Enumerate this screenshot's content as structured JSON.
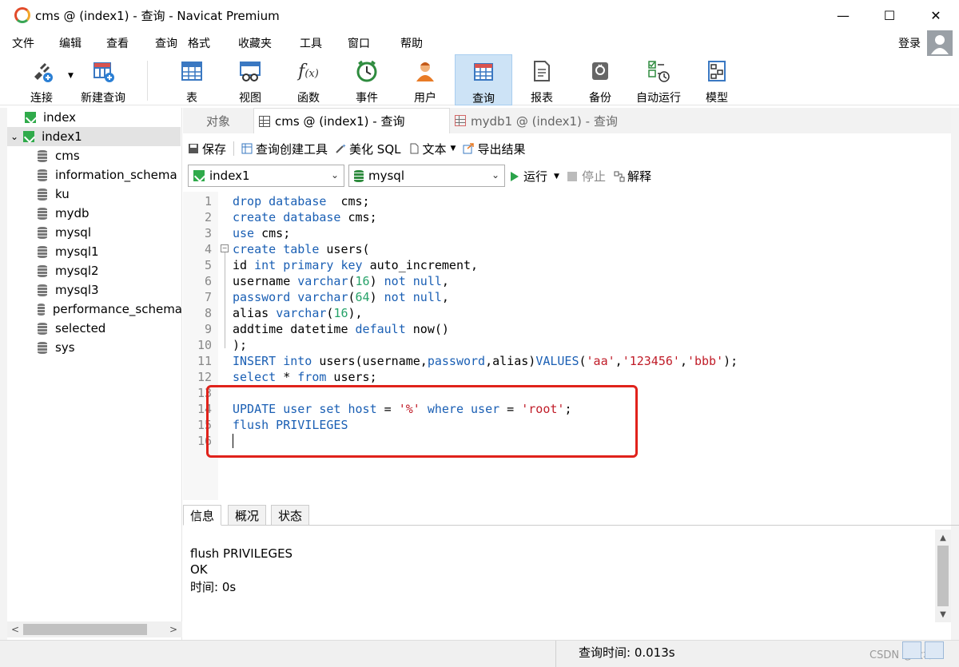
{
  "window": {
    "title": "cms @ (index1) - 查询 - Navicat Premium",
    "minimize": "—",
    "maximize": "☐",
    "close": "✕"
  },
  "menu": {
    "items": [
      "文件",
      "编辑",
      "查看",
      "查询",
      "格式",
      "收藏夹",
      "工具",
      "窗口",
      "帮助"
    ],
    "login": "登录"
  },
  "toolbar": {
    "items": [
      {
        "label": "连接",
        "icon": "plug-icon"
      },
      {
        "label": "新建查询",
        "icon": "new-query-icon"
      },
      {
        "label": "表",
        "icon": "table-icon"
      },
      {
        "label": "视图",
        "icon": "view-icon"
      },
      {
        "label": "函数",
        "icon": "function-icon"
      },
      {
        "label": "事件",
        "icon": "clock-icon"
      },
      {
        "label": "用户",
        "icon": "user-icon"
      },
      {
        "label": "查询",
        "icon": "query-icon",
        "active": true
      },
      {
        "label": "报表",
        "icon": "report-icon"
      },
      {
        "label": "备份",
        "icon": "backup-icon"
      },
      {
        "label": "自动运行",
        "icon": "automation-icon"
      },
      {
        "label": "模型",
        "icon": "model-icon"
      }
    ]
  },
  "sidebar": {
    "connections": [
      {
        "name": "index"
      },
      {
        "name": "index1",
        "expanded": true,
        "selected": true
      }
    ],
    "databases": [
      "cms",
      "information_schema",
      "ku",
      "mydb",
      "mysql",
      "mysql1",
      "mysql2",
      "mysql3",
      "performance_schema",
      "selected",
      "sys"
    ]
  },
  "tabs": {
    "objects": "对象",
    "active": "cms @ (index1) - 查询",
    "other": "mydb1 @ (index1) - 查询"
  },
  "query_toolbar": {
    "save": "保存",
    "builder": "查询创建工具",
    "beautify": "美化 SQL",
    "text": "文本",
    "export": "导出结果"
  },
  "selectors": {
    "connection": "index1",
    "database": "mysql",
    "run": "运行",
    "stop": "停止",
    "explain": "解释"
  },
  "editor": {
    "lines": [
      {
        "n": "1",
        "segs": [
          [
            "kw",
            "drop database"
          ],
          [
            "",
            "  cms;"
          ]
        ]
      },
      {
        "n": "2",
        "segs": [
          [
            "kw",
            "create database"
          ],
          [
            "",
            " cms;"
          ]
        ]
      },
      {
        "n": "3",
        "segs": [
          [
            "kw",
            "use"
          ],
          [
            "",
            " cms;"
          ]
        ]
      },
      {
        "n": "4",
        "segs": [
          [
            "kw",
            "create table"
          ],
          [
            "",
            " users("
          ]
        ]
      },
      {
        "n": "5",
        "segs": [
          [
            "",
            "id "
          ],
          [
            "kw",
            "int primary key"
          ],
          [
            "",
            " auto_increment,"
          ]
        ]
      },
      {
        "n": "6",
        "segs": [
          [
            "",
            "username "
          ],
          [
            "kw",
            "varchar"
          ],
          [
            "",
            "("
          ],
          [
            "num",
            "16"
          ],
          [
            "",
            ") "
          ],
          [
            "kw",
            "not null"
          ],
          [
            "",
            ","
          ]
        ]
      },
      {
        "n": "7",
        "segs": [
          [
            "kw",
            "password varchar"
          ],
          [
            "",
            "("
          ],
          [
            "num",
            "64"
          ],
          [
            "",
            ") "
          ],
          [
            "kw",
            "not null"
          ],
          [
            "",
            ","
          ]
        ]
      },
      {
        "n": "8",
        "segs": [
          [
            "",
            "alias "
          ],
          [
            "kw",
            "varchar"
          ],
          [
            "",
            "("
          ],
          [
            "num",
            "16"
          ],
          [
            "",
            "),"
          ]
        ]
      },
      {
        "n": "9",
        "segs": [
          [
            "",
            "addtime datetime "
          ],
          [
            "kw",
            "default"
          ],
          [
            "",
            " now()"
          ]
        ]
      },
      {
        "n": "10",
        "segs": [
          [
            "",
            ");"
          ]
        ]
      },
      {
        "n": "11",
        "segs": [
          [
            "kw",
            "INSERT into"
          ],
          [
            "",
            " users(username,"
          ],
          [
            "kw",
            "password"
          ],
          [
            "",
            ",alias)"
          ],
          [
            "kw",
            "VALUES"
          ],
          [
            "",
            "("
          ],
          [
            "str",
            "'aa'"
          ],
          [
            "",
            ","
          ],
          [
            "str",
            "'123456'"
          ],
          [
            "",
            ","
          ],
          [
            "str",
            "'bbb'"
          ],
          [
            "",
            ");"
          ]
        ]
      },
      {
        "n": "12",
        "segs": [
          [
            "kw",
            "select"
          ],
          [
            "",
            " * "
          ],
          [
            "kw",
            "from"
          ],
          [
            "",
            " users;"
          ]
        ]
      },
      {
        "n": "13",
        "segs": []
      },
      {
        "n": "14",
        "segs": [
          [
            "kw",
            "UPDATE user set host"
          ],
          [
            "",
            " = "
          ],
          [
            "str",
            "'%'"
          ],
          [
            "kw",
            " where user"
          ],
          [
            "",
            " = "
          ],
          [
            "str",
            "'root'"
          ],
          [
            "",
            ";"
          ]
        ]
      },
      {
        "n": "15",
        "segs": [
          [
            "kw",
            "flush PRIVILEGES"
          ]
        ]
      },
      {
        "n": "16",
        "segs": []
      }
    ]
  },
  "result": {
    "tabs": [
      "信息",
      "概况",
      "状态"
    ],
    "lines": [
      "flush PRIVILEGES",
      "OK",
      "时间: 0s"
    ]
  },
  "status": {
    "query_time": "查询时间: 0.013s",
    "watermark": "CSDN @大坤..."
  }
}
